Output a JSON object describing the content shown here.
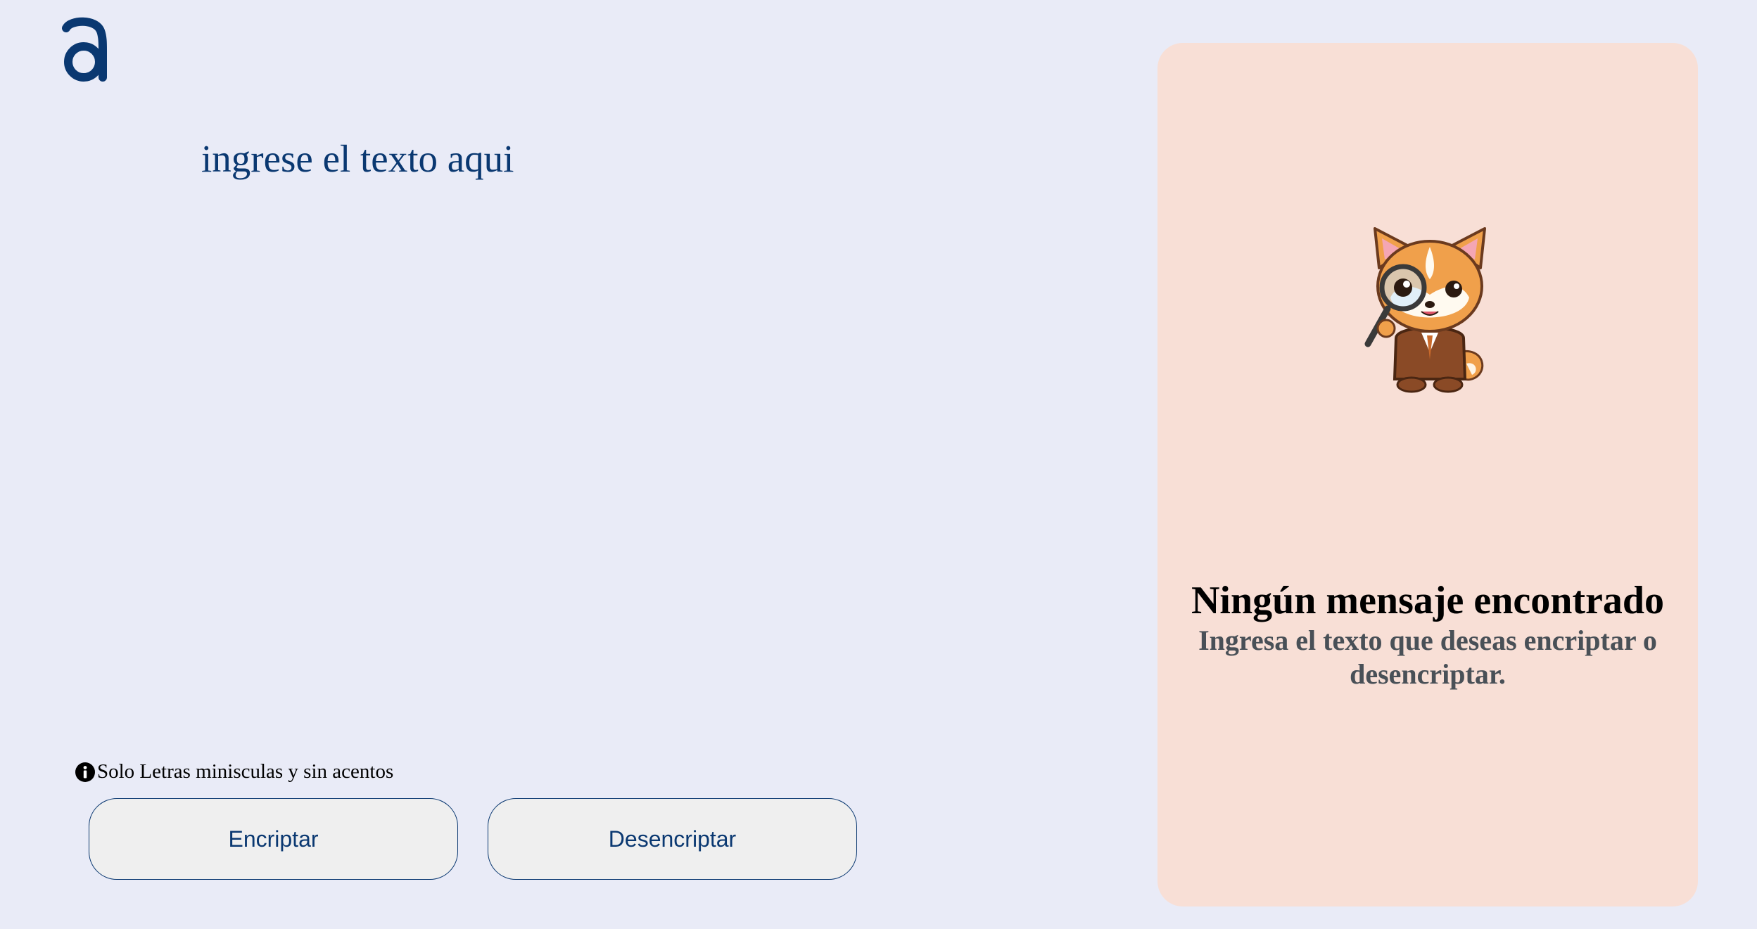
{
  "colors": {
    "background": "#e9ebf7",
    "primary": "#0a3871",
    "panel": "#f8dfd6",
    "button_bg": "#efefef",
    "subtext": "#495057"
  },
  "logo": {
    "icon": "alura-a-logo-icon"
  },
  "editor": {
    "placeholder": "ingrese el texto aqui"
  },
  "hint": {
    "icon": "info-circle-icon",
    "text": "Solo Letras minisculas y sin acentos"
  },
  "buttons": {
    "encrypt": "Encriptar",
    "decrypt": "Desencriptar"
  },
  "output_panel": {
    "image": "detective-shiba-mascot-image",
    "title": "Ningún mensaje encontrado",
    "subtitle": "Ingresa el texto que deseas encriptar o desencriptar."
  }
}
